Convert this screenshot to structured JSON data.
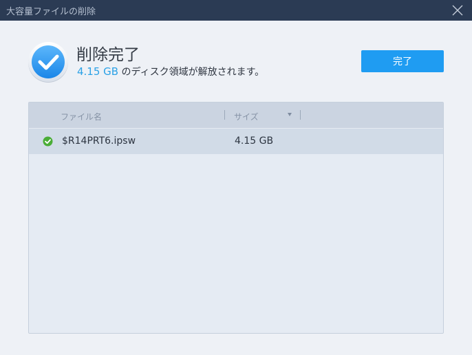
{
  "window": {
    "title": "大容量ファイルの削除",
    "close_icon": "close-icon"
  },
  "header": {
    "icon": "check-circle-icon",
    "title": "削除完了",
    "freed_size": "4.15 GB",
    "freed_suffix": " のディスク領域が解放されます。"
  },
  "actions": {
    "done_label": "完了"
  },
  "table": {
    "columns": {
      "name": "ファイル名",
      "size": "サイズ",
      "sort_icon": "sort-desc-icon"
    },
    "rows": [
      {
        "status_icon": "check-icon",
        "name": "$R14PRT6.ipsw",
        "size": "4.15 GB"
      }
    ]
  },
  "colors": {
    "titlebar": "#2b3b54",
    "accent": "#1f9cf2",
    "size_highlight": "#2aa1e6",
    "success": "#4aad37",
    "background": "#eef1f6"
  }
}
